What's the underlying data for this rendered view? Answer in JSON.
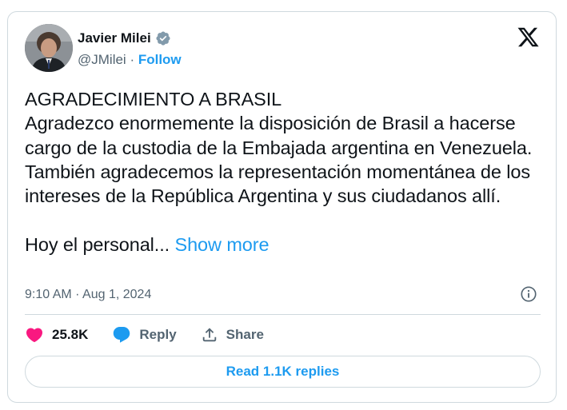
{
  "author": {
    "name": "Javier Milei",
    "handle": "@JMilei",
    "separator": " · ",
    "follow_label": "Follow"
  },
  "tweet": {
    "title_line": "AGRADECIMIENTO A BRASIL",
    "body": "Agradezco enormemente la disposición de Brasil a hacerse cargo de la custodia de la Embajada argentina en Venezuela. También agradecemos la representación momentánea de los intereses de la República Argentina y sus ciudadanos allí.",
    "truncated_text": "Hoy el personal...",
    "show_more_label": "Show more",
    "timestamp": "9:10 AM · Aug 1, 2024"
  },
  "engagement": {
    "likes": "25.8K",
    "reply_label": "Reply",
    "share_label": "Share"
  },
  "replies_button_label": "Read 1.1K replies",
  "colors": {
    "accent": "#1d9bf0",
    "like": "#f91880",
    "muted": "#536471",
    "border": "#cfd9de"
  },
  "icons": [
    "verified-badge-icon",
    "x-logo-icon",
    "info-icon",
    "heart-icon",
    "reply-bubble-icon",
    "share-icon"
  ]
}
